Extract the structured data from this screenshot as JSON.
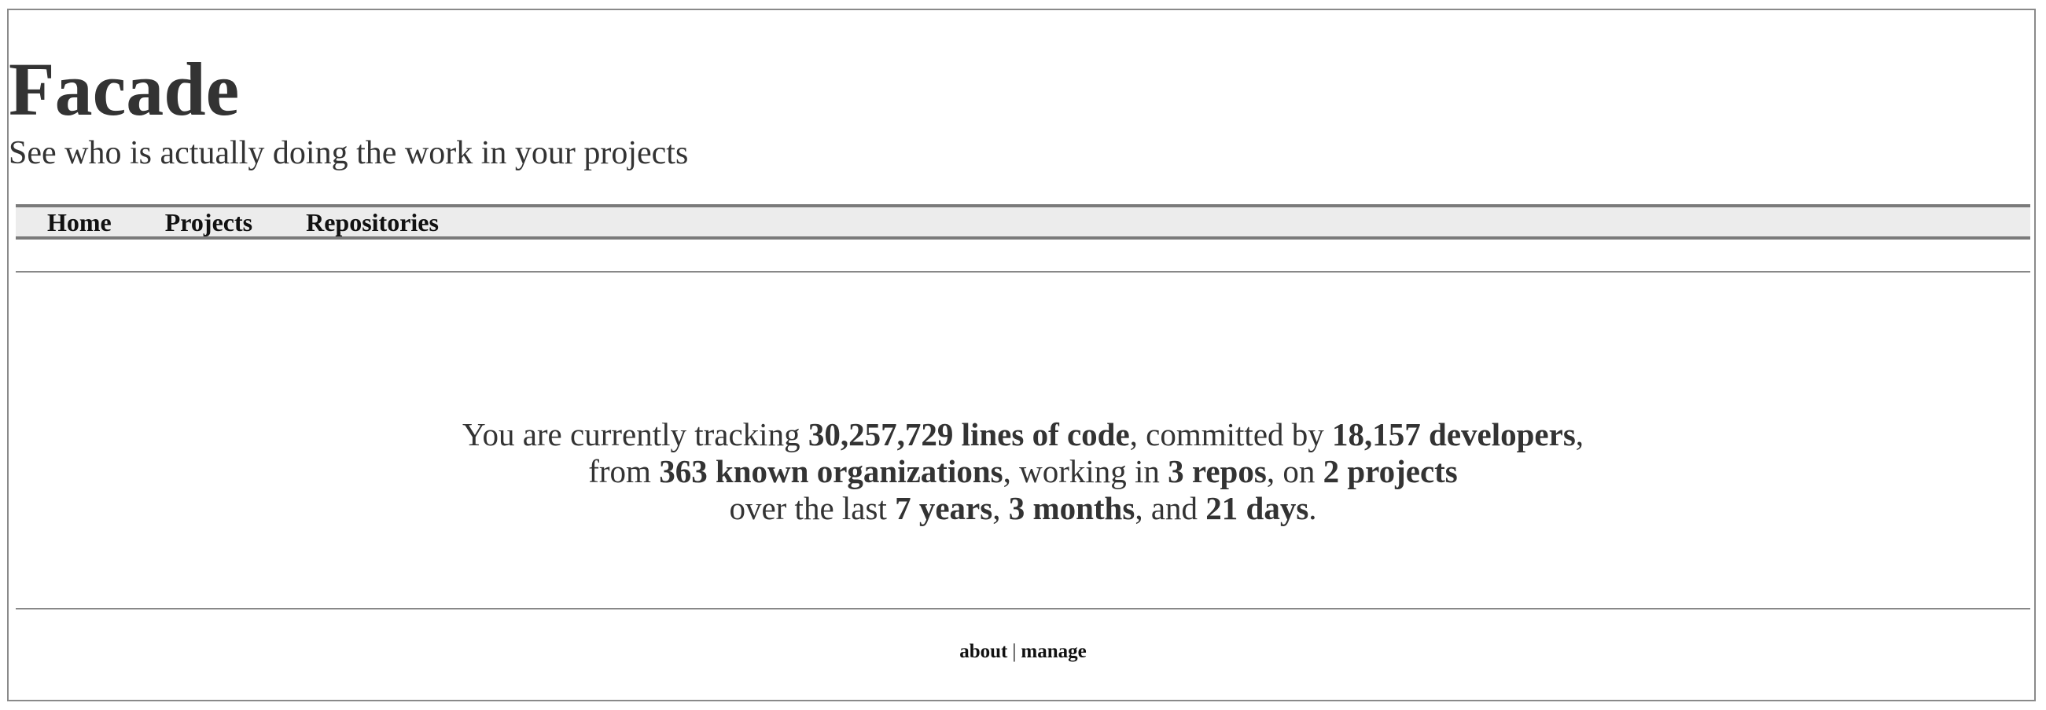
{
  "header": {
    "title": "Facade",
    "tagline": "See who is actually doing the work in your projects"
  },
  "nav": {
    "items": [
      {
        "label": "Home"
      },
      {
        "label": "Projects"
      },
      {
        "label": "Repositories"
      }
    ]
  },
  "summary": {
    "line1_prefix": "You are currently tracking ",
    "lines_of_code": "30,257,729 lines of code",
    "line1_mid": ", committed by ",
    "developers": "18,157 developers",
    "line1_suffix": ",",
    "line2_prefix": "from ",
    "organizations": "363 known organizations",
    "line2_mid": ", working in ",
    "repos": "3 repos",
    "line2_mid2": ", on ",
    "projects": "2 projects",
    "line3_prefix": "over the last ",
    "years": "7 years",
    "line3_sep1": ", ",
    "months": "3 months",
    "line3_sep2": ", and ",
    "days": "21 days",
    "line3_suffix": "."
  },
  "footer": {
    "about_label": "about",
    "separator": "|",
    "manage_label": "manage"
  }
}
